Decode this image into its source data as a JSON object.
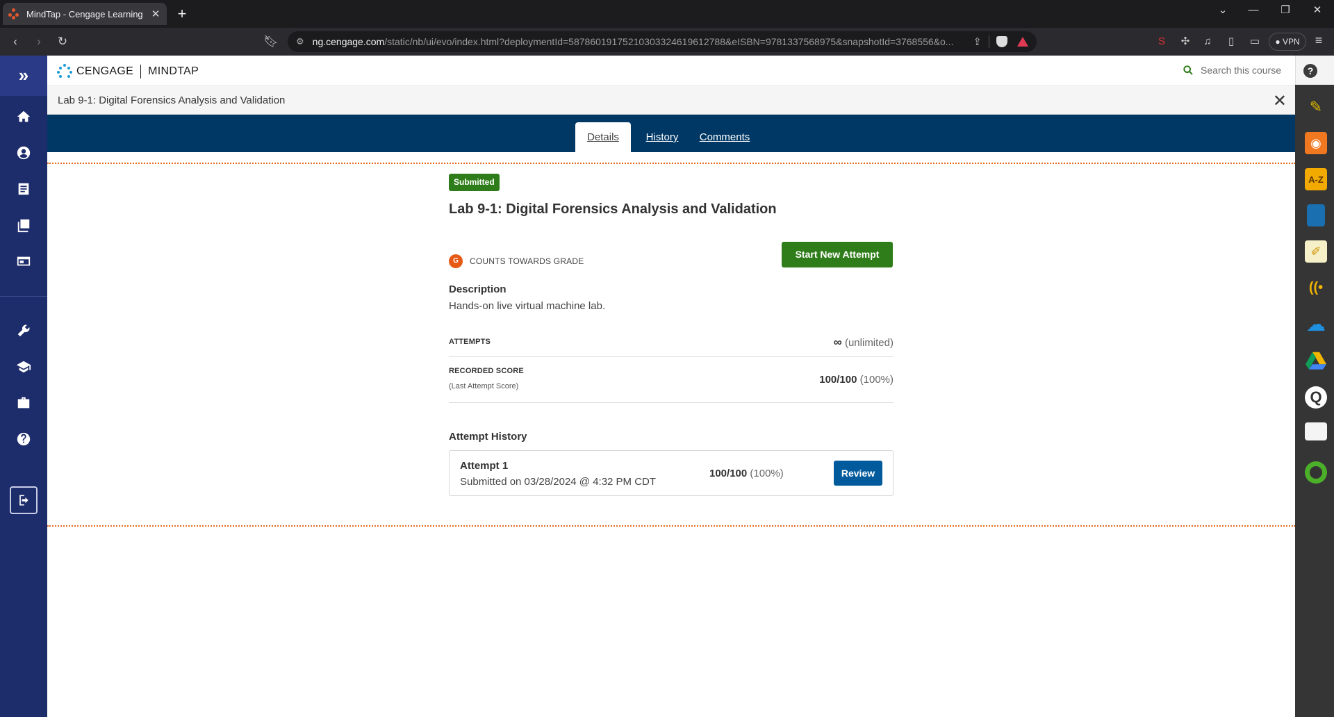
{
  "browser": {
    "tab_title": "MindTap - Cengage Learning",
    "tab_close": "✕",
    "new_tab": "+",
    "url_host": "ng.cengage.com",
    "url_path": "/static/nb/ui/evo/index.html?deploymentId=58786019175210303324619612788&eISBN=9781337568975&snapshotId=3768556&o...",
    "vpn_label": "VPN"
  },
  "left_nav": {
    "items": [
      "home-icon",
      "account-icon",
      "notes-icon",
      "library-icon",
      "card-icon",
      "wrench-icon",
      "graduation-cap-icon",
      "briefcase-icon",
      "help-icon"
    ]
  },
  "header": {
    "brand": "CENGAGE",
    "product": "MINDTAP",
    "search_placeholder": "Search this course"
  },
  "activity": {
    "title": "Lab 9-1: Digital Forensics Analysis and Validation",
    "close": "✕"
  },
  "tabs": [
    {
      "label": "Details",
      "active": true
    },
    {
      "label": "History",
      "active": false
    },
    {
      "label": "Comments",
      "active": false
    }
  ],
  "main": {
    "status_badge": "Submitted",
    "heading": "Lab 9-1: Digital Forensics Analysis and Validation",
    "grade_icon": "G",
    "grade_label": "COUNTS TOWARDS GRADE",
    "start_button": "Start New Attempt",
    "description_label": "Description",
    "description_text": "Hands-on live virtual machine lab.",
    "attempts_label": "ATTEMPTS",
    "attempts_symbol": "∞",
    "attempts_value": "(unlimited)",
    "score_label": "RECORDED SCORE",
    "score_sublabel": "(Last Attempt Score)",
    "score_value": "100/100",
    "score_percent": "(100%)",
    "history_label": "Attempt History",
    "attempts": [
      {
        "title": "Attempt 1",
        "submitted": "Submitted on 03/28/2024 @ 4:32 PM CDT",
        "score": "100/100",
        "percent": "(100%)",
        "review_label": "Review"
      }
    ]
  },
  "right_apps": [
    "pencil-app-icon",
    "rss-app-icon",
    "dictionary-app-icon",
    "book-app-icon",
    "notepad-app-icon",
    "readspeaker-app-icon",
    "onedrive-app-icon",
    "google-drive-app-icon",
    "search-app-icon",
    "flashcards-app-icon",
    "profile-app-icon"
  ],
  "colors": {
    "nav_bg": "#1d2c6b",
    "tab_band": "#003865",
    "success_green": "#2f7d1a",
    "review_blue": "#005a9c",
    "grade_orange": "#e65a15"
  }
}
